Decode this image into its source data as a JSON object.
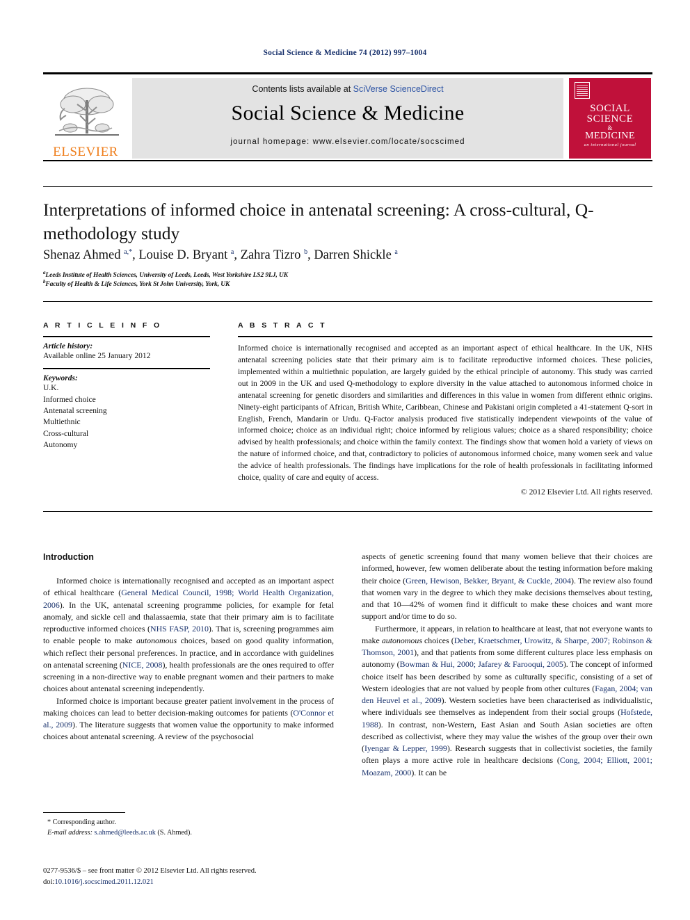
{
  "running_head": "Social Science & Medicine 74 (2012) 997–1004",
  "masthead": {
    "contents_prefix": "Contents lists available at ",
    "contents_link": "SciVerse ScienceDirect",
    "journal_title": "Social Science & Medicine",
    "homepage": "journal homepage: www.elsevier.com/locate/socscimed",
    "publisher_logo_text": "ELSEVIER",
    "cover": {
      "line1": "SOCIAL",
      "line2": "SCIENCE",
      "amp": "&",
      "line3": "MEDICINE",
      "line4": "an international journal"
    }
  },
  "article": {
    "title": "Interpretations of informed choice in antenatal screening: A cross-cultural, Q-methodology study",
    "authors_html": "Shenaz Ahmed <sup>a,*</sup>, Louise D. Bryant <sup>a</sup>, Zahra Tizro <sup>b</sup>, Darren Shickle <sup>a</sup>",
    "affiliation_a": "Leeds Institute of Health Sciences, University of Leeds, Leeds, West Yorkshire LS2 9LJ, UK",
    "affiliation_b": "Faculty of Health & Life Sciences, York St John University, York, UK"
  },
  "info": {
    "heading": "A R T I C L E   I N F O",
    "history_label": "Article history:",
    "history_value": "Available online 25 January 2012",
    "keywords_label": "Keywords:",
    "keywords": [
      "U.K.",
      "Informed choice",
      "Antenatal screening",
      "Multiethnic",
      "Cross-cultural",
      "Autonomy"
    ]
  },
  "abstract": {
    "heading": "A B S T R A C T",
    "text": "Informed choice is internationally recognised and accepted as an important aspect of ethical healthcare. In the UK, NHS antenatal screening policies state that their primary aim is to facilitate reproductive informed choices. These policies, implemented within a multiethnic population, are largely guided by the ethical principle of autonomy. This study was carried out in 2009 in the UK and used Q-methodology to explore diversity in the value attached to autonomous informed choice in antenatal screening for genetic disorders and similarities and differences in this value in women from different ethnic origins. Ninety-eight participants of African, British White, Caribbean, Chinese and Pakistani origin completed a 41-statement Q-sort in English, French, Mandarin or Urdu. Q-Factor analysis produced five statistically independent viewpoints of the value of informed choice; choice as an individual right; choice informed by religious values; choice as a shared responsibility; choice advised by health professionals; and choice within the family context. The findings show that women hold a variety of views on the nature of informed choice, and that, contradictory to policies of autonomous informed choice, many women seek and value the advice of health professionals. The findings have implications for the role of health professionals in facilitating informed choice, quality of care and equity of access.",
    "copyright": "© 2012 Elsevier Ltd. All rights reserved."
  },
  "body": {
    "section_heading": "Introduction",
    "left_paragraphs_html": [
      "Informed choice is internationally recognised and accepted as an important aspect of ethical healthcare (<span class=\"cite\">General Medical Council, 1998; World Health Organization, 2006</span>). In the UK, antenatal screening programme policies, for example for fetal anomaly, and sickle cell and thalassaemia, state that their primary aim is to facilitate reproductive informed choices (<span class=\"cite\">NHS FASP, 2010</span>). That is, screening programmes aim to enable people to make <em>autonomous</em> choices, based on good quality information, which reflect their personal preferences. In practice, and in accordance with guidelines on antenatal screening (<span class=\"cite\">NICE, 2008</span>), health professionals are the ones required to offer screening in a non-directive way to enable pregnant women and their partners to make choices about antenatal screening independently.",
      "Informed choice is important because greater patient involvement in the process of making choices can lead to better decision-making outcomes for patients (<span class=\"cite\">O'Connor et al., 2009</span>). The literature suggests that women value the opportunity to make informed choices about antenatal screening. A review of the psychosocial"
    ],
    "right_paragraphs_html": [
      "aspects of genetic screening found that many women believe that their choices are informed, however, few women deliberate about the testing information before making their choice (<span class=\"cite\">Green, Hewison, Bekker, Bryant, &amp; Cuckle, 2004</span>). The review also found that women vary in the degree to which they make decisions themselves about testing, and that 10&#8212;42% of women find it difficult to make these choices and want more support and/or time to do so.",
      "Furthermore, it appears, in relation to healthcare at least, that not everyone wants to make <em>autonomous</em> choices (<span class=\"cite\">Deber, Kraetschmer, Urowitz, &amp; Sharpe, 2007; Robinson &amp; Thomson, 2001</span>), and that patients from some different cultures place less emphasis on autonomy (<span class=\"cite\">Bowman &amp; Hui, 2000; Jafarey &amp; Farooqui, 2005</span>). The concept of informed choice itself has been described by some as culturally specific, consisting of a set of Western ideologies that are not valued by people from other cultures (<span class=\"cite\">Fagan, 2004; van den Heuvel et al., 2009</span>). Western societies have been characterised as individualistic, where individuals see themselves as independent from their social groups (<span class=\"cite\">Hofstede, 1988</span>). In contrast, non-Western, East Asian and South Asian societies are often described as collectivist, where they may value the wishes of the group over their own (<span class=\"cite\">Iyengar &amp; Lepper, 1999</span>). Research suggests that in collectivist societies, the family often plays a more active role in healthcare decisions (<span class=\"cite\">Cong, 2004; Elliott, 2001; Moazam, 2000</span>). It can be"
    ]
  },
  "footnote": {
    "corresponding": "* Corresponding author.",
    "email_label": "E-mail address:",
    "email": "s.ahmed@leeds.ac.uk",
    "email_suffix": "(S. Ahmed)."
  },
  "footer": {
    "front_matter": "0277-9536/$ – see front matter © 2012 Elsevier Ltd. All rights reserved.",
    "doi_label": "doi:",
    "doi_value": "10.1016/j.socscimed.2011.12.021"
  },
  "colors": {
    "link_blue": "#17306b",
    "sciverse_blue": "#2b52a4",
    "elsevier_orange": "#ef7d1a",
    "cover_crimson": "#c0113a",
    "masthead_grey": "#e3e3e3"
  }
}
